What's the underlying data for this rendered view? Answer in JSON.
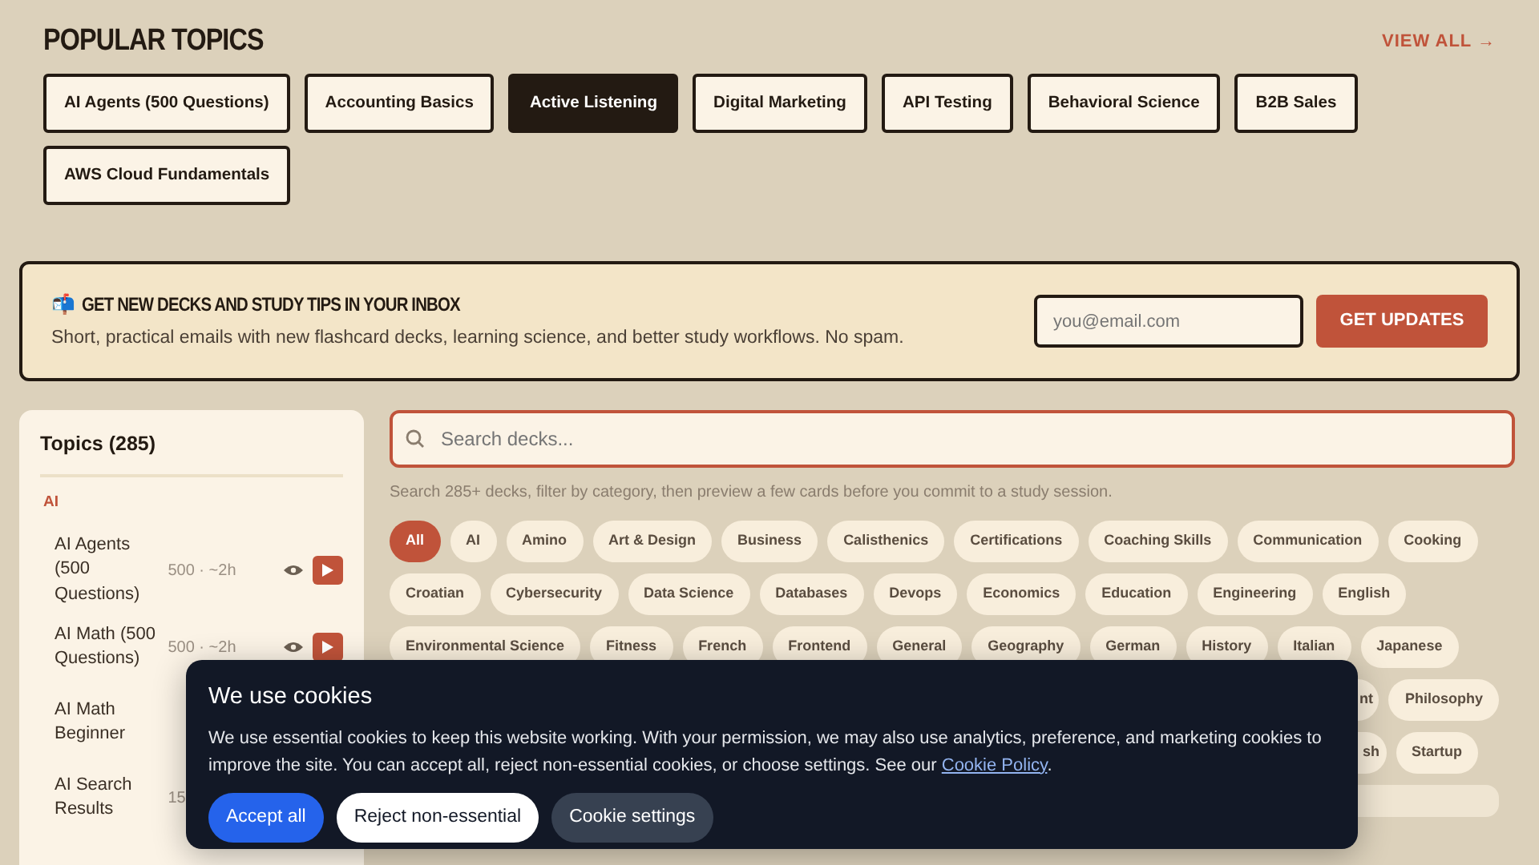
{
  "popular_topics": {
    "title": "POPULAR TOPICS",
    "view_all": "VIEW ALL →",
    "topics": [
      {
        "label": "AI Agents (500 Questions)",
        "selected": false
      },
      {
        "label": "Accounting Basics",
        "selected": false
      },
      {
        "label": "Active Listening",
        "selected": true
      },
      {
        "label": "Digital Marketing",
        "selected": false
      },
      {
        "label": "API Testing",
        "selected": false
      },
      {
        "label": "Behavioral Science",
        "selected": false
      },
      {
        "label": "B2B Sales",
        "selected": false
      },
      {
        "label": "AWS Cloud Fundamentals",
        "selected": false
      }
    ]
  },
  "newsletter": {
    "icon": "📬",
    "title": "GET NEW DECKS AND STUDY TIPS IN YOUR INBOX",
    "text": "Short, practical emails with new flashcard decks, learning science, and better study workflows. No spam.",
    "placeholder": "you@email.com",
    "button": "GET UPDATES"
  },
  "sidebar": {
    "title": "Topics (285)",
    "group": "AI",
    "items": [
      {
        "label": "AI Agents (500 Questions)",
        "meta": "500 · ~2h"
      },
      {
        "label": "AI Math (500 Questions)",
        "meta": "500 · ~2h"
      },
      {
        "label": "AI Math Beginner"
      },
      {
        "label": "AI Search Results",
        "meta": "15"
      }
    ]
  },
  "search": {
    "placeholder": "Search decks...",
    "hint": "Search 285+ decks, filter by category, then preview a few cards before you commit to a study session."
  },
  "category_rows": [
    [
      {
        "label": "All",
        "selected": true
      },
      {
        "label": "AI",
        "selected": false
      },
      {
        "label": "Amino",
        "selected": false
      },
      {
        "label": "Art & Design",
        "selected": false
      },
      {
        "label": "Business",
        "selected": false
      },
      {
        "label": "Calisthenics",
        "selected": false
      },
      {
        "label": "Certifications",
        "selected": false
      },
      {
        "label": "Coaching Skills",
        "selected": false
      },
      {
        "label": "Communication",
        "selected": false
      },
      {
        "label": "Cooking",
        "selected": false
      }
    ],
    [
      {
        "label": "Croatian",
        "selected": false
      },
      {
        "label": "Cybersecurity",
        "selected": false
      },
      {
        "label": "Data Science",
        "selected": false
      },
      {
        "label": "Databases",
        "selected": false
      },
      {
        "label": "Devops",
        "selected": false
      },
      {
        "label": "Economics",
        "selected": false
      },
      {
        "label": "Education",
        "selected": false
      },
      {
        "label": "Engineering",
        "selected": false
      },
      {
        "label": "English",
        "selected": false
      }
    ],
    [
      {
        "label": "Environmental Science",
        "selected": false
      },
      {
        "label": "Fitness",
        "selected": false
      },
      {
        "label": "French",
        "selected": false
      },
      {
        "label": "Frontend",
        "selected": false
      },
      {
        "label": "General",
        "selected": false
      },
      {
        "label": "Geography",
        "selected": false
      },
      {
        "label": "German",
        "selected": false
      },
      {
        "label": "History",
        "selected": false
      },
      {
        "label": "Italian",
        "selected": false
      },
      {
        "label": "Japanese",
        "selected": false
      }
    ],
    [
      {
        "label": "nt",
        "selected": false
      },
      {
        "label": "Philosophy",
        "selected": false
      }
    ],
    [
      {
        "label": "sh",
        "selected": false
      },
      {
        "label": "Startup",
        "selected": false
      }
    ]
  ],
  "cookie_banner": {
    "title": "We use cookies",
    "text": "We use essential cookies to keep this website working. With your permission, we may also use analytics, preference, and marketing cookies to improve the site. You can accept all, reject non-essential cookies, or choose settings. See our ",
    "link": "Cookie Policy",
    "text_end": ".",
    "buttons": [
      {
        "label": "Accept all",
        "kind": "primary"
      },
      {
        "label": "Reject non-essential",
        "kind": "light"
      },
      {
        "label": "Cookie settings",
        "kind": "dark"
      }
    ]
  }
}
